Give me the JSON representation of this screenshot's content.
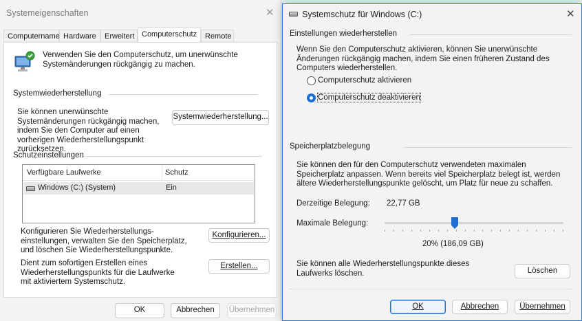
{
  "system_properties": {
    "title": "Systemeigenschaften",
    "tabs": [
      "Computername",
      "Hardware",
      "Erweitert",
      "Computerschutz",
      "Remote"
    ],
    "active_tab": "Computerschutz",
    "intro": "Verwenden Sie den Computerschutz, um unerwünschte Systemänderungen rückgängig zu machen.",
    "restore_group_label": "Systemwiederherstellung",
    "restore_desc": "Sie können unerwünschte Systemänderungen rückgängig machen, indem Sie den Computer auf einen vorherigen Wiederherstellungspunkt zurücksetzen.",
    "restore_button": "Systemwiederherstellung...",
    "protection_group_label": "Schutzeinstellungen",
    "table": {
      "columns": [
        "Verfügbare Laufwerke",
        "Schutz"
      ],
      "rows": [
        {
          "drive": "Windows (C:) (System)",
          "protection": "Ein"
        }
      ]
    },
    "configure_desc": "Konfigurieren Sie Wiederherstellungs-einstellungen, verwalten Sie den Speicherplatz, und löschen Sie Wiederherstellungspunkte.",
    "configure_button": "Konfigurieren...",
    "create_desc": "Dient zum sofortigen Erstellen eines Wiederherstellungspunkts für die Laufwerke mit aktiviertem Systemschutz.",
    "create_button": "Erstellen...",
    "ok_button": "OK",
    "cancel_button": "Abbrechen",
    "apply_button": "Übernehmen"
  },
  "system_protection": {
    "title": "Systemschutz für Windows (C:)",
    "restore_settings_label": "Einstellungen wiederherstellen",
    "restore_settings_desc": "Wenn Sie den Computerschutz aktivieren, können Sie unerwünschte Änderungen rückgängig machen, indem Sie einen früheren Zustand des Computers wiederherstellen.",
    "radio_enable": "Computerschutz aktivieren",
    "radio_disable": "Computerschutz deaktivieren",
    "selected_option": "Computerschutz deaktivieren",
    "disk_usage_label": "Speicherplatzbelegung",
    "disk_usage_desc": "Sie können den für den Computerschutz verwendeten maximalen Speicherplatz anpassen. Wenn bereits viel Speicherplatz belegt ist, werden ältere Wiederherstellungspunkte gelöscht, um Platz für neue zu schaffen.",
    "current_usage_label": "Derzeitige Belegung:",
    "current_usage_value": "22,77 GB",
    "max_usage_label": "Maximale Belegung:",
    "max_usage_percent": 20,
    "max_usage_value": "20% (186,09 GB)",
    "delete_desc": "Sie können alle Wiederherstellungspunkte dieses Laufwerks löschen.",
    "delete_button": "Löschen",
    "ok_button": "OK",
    "cancel_button": "Abbrechen",
    "apply_button": "Übernehmen"
  },
  "colors": {
    "accent": "#1f6fd1",
    "window_bg": "#f3f3f3",
    "panel_bg": "#ffffff"
  },
  "icons": [
    "system-restore-icon",
    "drive-icon",
    "close-icon"
  ]
}
